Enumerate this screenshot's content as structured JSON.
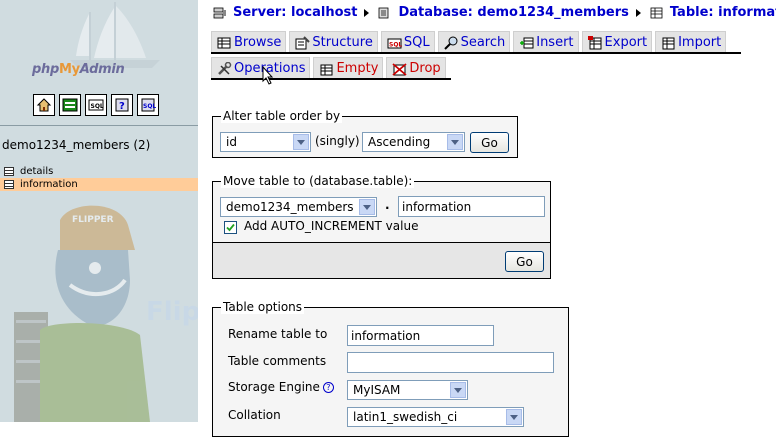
{
  "nav": {
    "logo": {
      "php": "php",
      "my": "My",
      "admin": "Admin"
    },
    "icons": [
      "home-icon",
      "query-window-icon",
      "sql-icon",
      "docs-icon",
      "sql-docs-icon"
    ],
    "database_label": "demo1234_members (2)",
    "tables": [
      {
        "label": "details",
        "selected": false
      },
      {
        "label": "information",
        "selected": true
      }
    ],
    "watermark": "FlipperHost"
  },
  "breadcrumb": {
    "server": "Server: localhost",
    "database": "Database: demo1234_members",
    "table": "Table: information"
  },
  "tabs_row1": [
    {
      "label": "Browse",
      "icon": "browse-icon"
    },
    {
      "label": "Structure",
      "icon": "structure-icon"
    },
    {
      "label": "SQL",
      "icon": "sql-icon"
    },
    {
      "label": "Search",
      "icon": "search-icon"
    },
    {
      "label": "Insert",
      "icon": "insert-icon"
    },
    {
      "label": "Export",
      "icon": "export-icon"
    },
    {
      "label": "Import",
      "icon": "import-icon"
    }
  ],
  "tabs_row2": [
    {
      "label": "Operations",
      "icon": "operations-icon"
    },
    {
      "label": "Empty",
      "icon": "empty-icon"
    },
    {
      "label": "Drop",
      "icon": "drop-icon"
    }
  ],
  "alter_order": {
    "legend": "Alter table order by",
    "column_value": "id",
    "singly_label": "(singly)",
    "direction_value": "Ascending",
    "go_label": "Go"
  },
  "move_table": {
    "legend": "Move table to (database.table):",
    "database_value": "demo1234_members",
    "separator": ".",
    "table_value": "information",
    "auto_increment_label": "Add AUTO_INCREMENT value",
    "auto_increment_checked": true,
    "go_label": "Go"
  },
  "table_options": {
    "legend": "Table options",
    "rename_label": "Rename table to",
    "rename_value": "information",
    "comments_label": "Table comments",
    "comments_value": "",
    "engine_label": "Storage Engine",
    "engine_help": "?",
    "engine_value": "MyISAM",
    "collation_label": "Collation",
    "collation_value": "latin1_swedish_ci"
  }
}
